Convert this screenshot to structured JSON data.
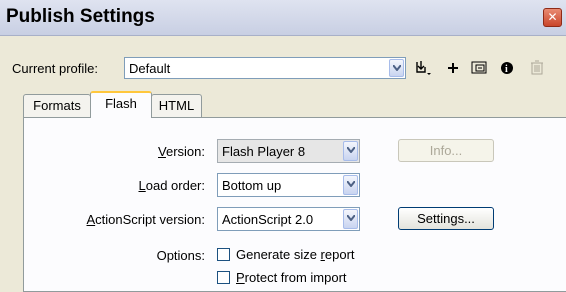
{
  "window": {
    "title": "Publish Settings",
    "close_label": "✕"
  },
  "profile": {
    "label": "Current profile:",
    "value": "Default",
    "toolbar_icons": [
      "import-export-icon",
      "add-profile-icon",
      "duplicate-profile-icon",
      "profile-info-icon",
      "delete-profile-icon"
    ]
  },
  "tabs": [
    "Formats",
    "Flash",
    "HTML"
  ],
  "active_tab": "Flash",
  "flash": {
    "version_label": "Version:",
    "version_value": "Flash Player 8",
    "info_button": "Info...",
    "load_order_label": "Load order:",
    "load_order_value": "Bottom up",
    "actionscript_label": "ActionScript version:",
    "actionscript_value": "ActionScript 2.0",
    "settings_button": "Settings...",
    "options_label": "Options:",
    "options": [
      {
        "label": "Generate size report",
        "checked": false
      },
      {
        "label": "Protect from import",
        "checked": false
      }
    ]
  },
  "colors": {
    "tab_highlight": "#ffc73c",
    "close_button": "#c9462b",
    "input_border": "#7f9db9"
  }
}
